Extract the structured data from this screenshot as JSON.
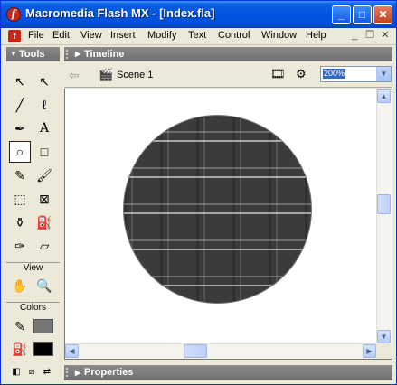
{
  "window": {
    "title": "Macromedia Flash MX - [Index.fla]",
    "app_icon": "flash-icon",
    "minimize_glyph": "_",
    "maximize_glyph": "□",
    "close_glyph": "✕"
  },
  "menubar": {
    "items": [
      "File",
      "Edit",
      "View",
      "Insert",
      "Modify",
      "Text",
      "Control",
      "Window",
      "Help"
    ]
  },
  "tools_panel": {
    "title": "Tools",
    "view_label": "View",
    "colors_label": "Colors"
  },
  "timeline": {
    "title": "Timeline"
  },
  "scene": {
    "label": "Scene 1",
    "zoom": "200%"
  },
  "properties": {
    "title": "Properties"
  },
  "colors": {
    "title_bar": "#0054e3",
    "panel_header": "#7a7a7a",
    "stage": "#ffffff",
    "circle_fill": "#3b3b3b"
  }
}
